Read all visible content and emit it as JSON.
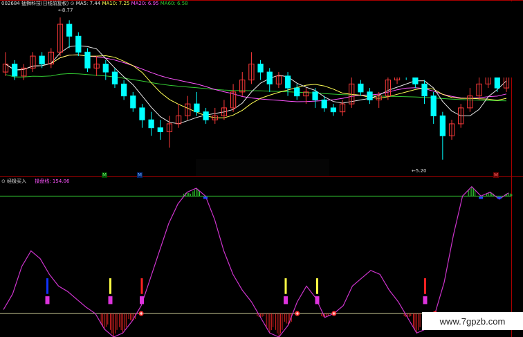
{
  "header": {
    "code_name": "002684 猛狮科技(日线前复权)",
    "ma5": "MA5: 7.44",
    "ma10": "MA10: 7.25",
    "ma20": "MA20: 6.95",
    "ma60": "MA60: 6.58"
  },
  "price_labels": {
    "high": "8.77",
    "low": "5.20"
  },
  "event_markers": {
    "m1": "M",
    "m2": "M",
    "m3": "M"
  },
  "indicator": {
    "name": "经极买入",
    "line_label": "操盘线: 154.06"
  },
  "watermark": "www.7gpzb.com",
  "colors": {
    "up": "#ff3a3a",
    "down": "#00ffff",
    "ma5": "#e6e6e6",
    "ma10": "#ffff55",
    "ma20": "#ff55ff",
    "ma60": "#33cc33",
    "osc": "#cc33cc"
  },
  "chart_data": [
    {
      "type": "candlestick",
      "title": "002684 猛狮科技(日线前复权)",
      "ylim": [
        4.9,
        9.0
      ],
      "ma": {
        "MA5": 7.44,
        "MA10": 7.25,
        "MA20": 6.95,
        "MA60": 6.58
      },
      "candles": [
        [
          7.4,
          7.6,
          7.9,
          7.3
        ],
        [
          7.6,
          7.3,
          7.7,
          7.2
        ],
        [
          7.3,
          7.5,
          7.6,
          7.2
        ],
        [
          7.5,
          7.8,
          7.9,
          7.4
        ],
        [
          7.8,
          7.6,
          7.9,
          7.5
        ],
        [
          7.6,
          7.9,
          8.0,
          7.5
        ],
        [
          7.9,
          8.6,
          8.77,
          7.8
        ],
        [
          8.6,
          8.3,
          8.7,
          8.0
        ],
        [
          8.3,
          7.9,
          8.4,
          7.8
        ],
        [
          7.9,
          7.5,
          8.0,
          7.4
        ],
        [
          7.5,
          7.6,
          7.8,
          7.3
        ],
        [
          7.6,
          7.4,
          7.7,
          7.2
        ],
        [
          7.4,
          7.1,
          7.5,
          7.0
        ],
        [
          7.1,
          6.8,
          7.2,
          6.7
        ],
        [
          6.8,
          6.5,
          6.9,
          6.4
        ],
        [
          6.5,
          6.2,
          6.6,
          6.0
        ],
        [
          6.2,
          6.0,
          6.4,
          5.8
        ],
        [
          6.0,
          5.9,
          6.2,
          5.7
        ],
        [
          5.9,
          6.1,
          6.3,
          5.5
        ],
        [
          6.1,
          6.3,
          6.6,
          6.0
        ],
        [
          6.3,
          6.6,
          6.8,
          6.2
        ],
        [
          6.6,
          6.4,
          6.9,
          6.3
        ],
        [
          6.4,
          6.2,
          6.5,
          6.1
        ],
        [
          6.2,
          6.3,
          6.5,
          6.1
        ],
        [
          6.3,
          6.5,
          6.7,
          6.2
        ],
        [
          6.5,
          6.9,
          7.1,
          6.4
        ],
        [
          6.9,
          7.2,
          7.4,
          6.8
        ],
        [
          7.2,
          7.6,
          7.9,
          7.1
        ],
        [
          7.6,
          7.4,
          7.7,
          7.2
        ],
        [
          7.4,
          7.1,
          7.5,
          6.9
        ],
        [
          7.1,
          7.3,
          7.4,
          7.0
        ],
        [
          7.3,
          7.0,
          7.4,
          6.8
        ],
        [
          7.0,
          6.8,
          7.1,
          6.7
        ],
        [
          6.8,
          6.9,
          7.0,
          6.6
        ],
        [
          6.9,
          6.7,
          7.0,
          6.5
        ],
        [
          6.7,
          6.5,
          6.8,
          6.4
        ],
        [
          6.5,
          6.4,
          6.6,
          6.3
        ],
        [
          6.4,
          6.6,
          6.7,
          6.3
        ],
        [
          6.6,
          7.1,
          7.5,
          6.5
        ],
        [
          7.1,
          6.9,
          7.2,
          6.8
        ],
        [
          6.9,
          6.7,
          7.0,
          6.6
        ],
        [
          6.7,
          6.8,
          6.9,
          6.5
        ],
        [
          6.8,
          7.2,
          7.4,
          6.7
        ],
        [
          7.2,
          7.5,
          7.6,
          7.1
        ],
        [
          7.5,
          7.3,
          7.7,
          7.2
        ],
        [
          7.3,
          7.1,
          7.4,
          7.0
        ],
        [
          7.1,
          6.8,
          7.2,
          6.6
        ],
        [
          6.8,
          6.3,
          6.9,
          6.1
        ],
        [
          6.3,
          5.8,
          6.4,
          5.2
        ],
        [
          5.8,
          6.1,
          6.2,
          5.7
        ],
        [
          6.1,
          6.5,
          6.6,
          6.0
        ],
        [
          6.5,
          6.8,
          7.0,
          6.4
        ],
        [
          6.8,
          7.1,
          7.3,
          6.7
        ],
        [
          7.1,
          7.4,
          7.6,
          7.0
        ],
        [
          7.4,
          7.0,
          7.5,
          6.9
        ],
        [
          7.0,
          7.6,
          7.9,
          6.9
        ]
      ]
    },
    {
      "type": "line",
      "title": "经极买入",
      "series": [
        {
          "name": "操盘线",
          "last": 154.06
        }
      ],
      "ylim": [
        -15,
        160
      ],
      "ref_lines": [
        0,
        150
      ],
      "values": [
        5,
        25,
        60,
        80,
        70,
        50,
        35,
        28,
        18,
        8,
        0,
        -20,
        -30,
        -25,
        -10,
        10,
        45,
        80,
        115,
        140,
        155,
        160,
        150,
        120,
        80,
        50,
        30,
        15,
        -5,
        -25,
        -30,
        -15,
        15,
        35,
        20,
        -5,
        0,
        10,
        35,
        45,
        55,
        50,
        30,
        15,
        -5,
        -25,
        -20,
        0,
        40,
        100,
        150,
        162,
        150,
        155,
        146,
        154.06
      ]
    }
  ]
}
